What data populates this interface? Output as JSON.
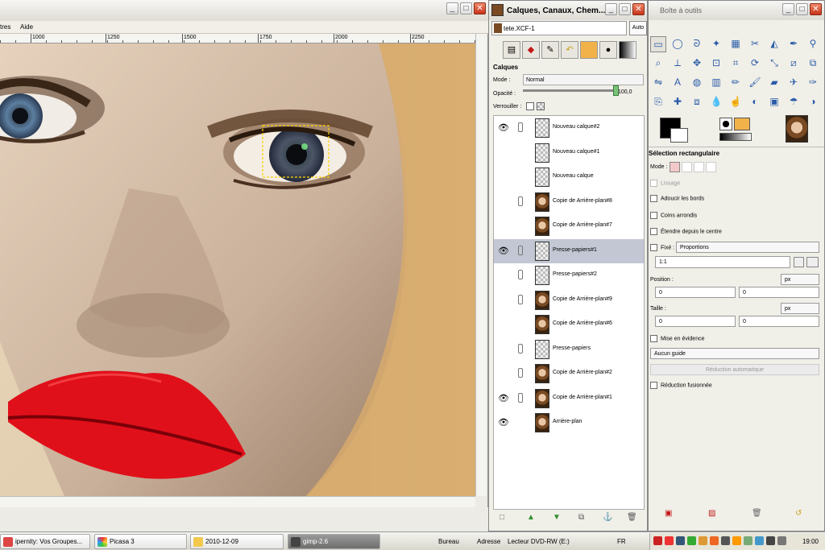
{
  "image_window": {
    "menu": {
      "item1": "tres",
      "item2": "Aide"
    },
    "ruler_labels": [
      "1000",
      "1250",
      "1500",
      "1750",
      "2000",
      "2250"
    ]
  },
  "layers_dock": {
    "title": "Calques, Canaux, Chem...",
    "image_name": "tete.XCF-1",
    "auto_label": "Auto",
    "section_title": "Calques",
    "mode_label": "Mode :",
    "mode_value": "Normal",
    "opacity_label": "Opacité :",
    "opacity_value": "100,0",
    "lock_label": "Verrouiller :",
    "layers": [
      {
        "name": "Nouveau calque#2",
        "visible": true,
        "linked": true,
        "thumb": "trans",
        "selected": false
      },
      {
        "name": "Nouveau calque#1",
        "visible": false,
        "linked": false,
        "thumb": "trans",
        "selected": false
      },
      {
        "name": "Nouveau calque",
        "visible": false,
        "linked": false,
        "thumb": "trans",
        "selected": false
      },
      {
        "name": "Copie de Arrière-plan#8",
        "visible": false,
        "linked": true,
        "thumb": "face",
        "selected": false
      },
      {
        "name": "Copie de Arrière-plan#7",
        "visible": false,
        "linked": false,
        "thumb": "face",
        "selected": false
      },
      {
        "name": "Presse-papiers#1",
        "visible": true,
        "linked": true,
        "thumb": "trans",
        "selected": true
      },
      {
        "name": "Presse-papiers#2",
        "visible": false,
        "linked": true,
        "thumb": "trans",
        "selected": false
      },
      {
        "name": "Copie de Arrière-plan#9",
        "visible": false,
        "linked": true,
        "thumb": "face",
        "selected": false
      },
      {
        "name": "Copie de Arrière-plan#6",
        "visible": false,
        "linked": false,
        "thumb": "face",
        "selected": false
      },
      {
        "name": "Presse-papiers",
        "visible": false,
        "linked": true,
        "thumb": "trans",
        "selected": false
      },
      {
        "name": "Copie de Arrière-plan#2",
        "visible": false,
        "linked": true,
        "thumb": "face",
        "selected": false
      },
      {
        "name": "Copie de Arrière-plan#1",
        "visible": true,
        "linked": true,
        "thumb": "face",
        "selected": false
      },
      {
        "name": "Arrière-plan",
        "visible": true,
        "linked": false,
        "thumb": "face",
        "selected": false
      }
    ]
  },
  "toolbox": {
    "title": "Boîte à outils",
    "options_title": "Sélection rectangulaire",
    "mode_label": "Mode :",
    "antialias": "Lissage",
    "feather": "Adoucir les bords",
    "rounded": "Coins arrondis",
    "expand_center": "Étendre depuis le centre",
    "fixed_label": "Fixé :",
    "fixed_value": "Proportions",
    "ratio_value": "1:1",
    "position_label": "Position :",
    "position_unit": "px",
    "position_x": "0",
    "position_y": "0",
    "size_label": "Taille :",
    "size_unit": "px",
    "size_w": "0",
    "size_h": "0",
    "highlight": "Mise en évidence",
    "guides_value": "Aucun guide",
    "autoshrink": "Réduction automatique",
    "shrink_merged": "Réduction fusionnée"
  },
  "taskbar": {
    "tasks": [
      "ipernity: Vos Groupes...",
      "Picasa 3",
      "2010-12-09",
      "gimp-2.6"
    ],
    "bureau": "Bureau",
    "adresse": "Adresse",
    "drive": "Lecteur DVD-RW (E:)",
    "lang": "FR",
    "clock": "19:00"
  }
}
